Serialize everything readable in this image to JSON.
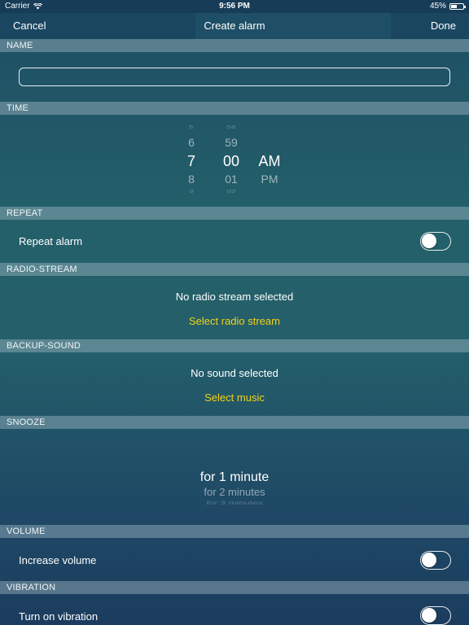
{
  "status_bar": {
    "carrier": "Carrier",
    "time": "9:56 PM",
    "battery": "45%"
  },
  "nav": {
    "cancel": "Cancel",
    "title": "Create alarm",
    "done": "Done"
  },
  "sections": {
    "name": "NAME",
    "time": "TIME",
    "repeat": "REPEAT",
    "radio": "RADIO-STREAM",
    "backup": "BACKUP-SOUND",
    "snooze": "SNOOZE",
    "volume": "VOLUME",
    "vibration": "VIBRATION"
  },
  "name_input": {
    "value": "",
    "placeholder": ""
  },
  "time_picker": {
    "hours": [
      "5",
      "6",
      "7",
      "8",
      "9"
    ],
    "minutes": [
      "58",
      "59",
      "00",
      "01",
      "02"
    ],
    "periods": [
      "AM",
      "PM"
    ],
    "selected": {
      "hour": "7",
      "minute": "00",
      "period": "AM"
    }
  },
  "repeat": {
    "label": "Repeat alarm",
    "on": false
  },
  "radio_stream": {
    "status": "No radio stream selected",
    "action": "Select radio stream"
  },
  "backup_sound": {
    "status": "No sound selected",
    "action": "Select music"
  },
  "snooze_picker": {
    "options": [
      "for 1 minute",
      "for 2 minutes",
      "for 3 minutes"
    ],
    "selected": "for 1 minute"
  },
  "volume": {
    "label": "Increase volume",
    "on": false
  },
  "vibration": {
    "label": "Turn on vibration",
    "on": false
  },
  "colors": {
    "accent_link": "#f2d21b",
    "header_bg": "#1a4660"
  }
}
